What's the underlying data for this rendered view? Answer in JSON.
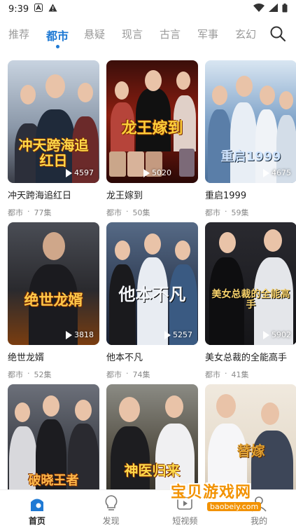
{
  "status_bar": {
    "time": "9:39"
  },
  "tabs": [
    {
      "label": "推荐",
      "active": false
    },
    {
      "label": "都市",
      "active": true
    },
    {
      "label": "悬疑",
      "active": false
    },
    {
      "label": "现言",
      "active": false
    },
    {
      "label": "古言",
      "active": false
    },
    {
      "label": "军事",
      "active": false
    },
    {
      "label": "玄幻",
      "active": false
    }
  ],
  "dramas": [
    {
      "title": "冲天跨海追红日",
      "genre": "都市",
      "episodes": "77集",
      "plays": "4597",
      "poster_text": "冲天跨海追红日",
      "theme": "#b8c6d8"
    },
    {
      "title": "龙王嫁到",
      "genre": "都市",
      "episodes": "50集",
      "plays": "5020",
      "poster_text": "龙王嫁到",
      "theme": "#6b1a12"
    },
    {
      "title": "重启1999",
      "genre": "都市",
      "episodes": "59集",
      "plays": "4675",
      "poster_text": "重启1999",
      "theme": "#5c86b5"
    },
    {
      "title": "绝世龙婿",
      "genre": "都市",
      "episodes": "52集",
      "plays": "3818",
      "poster_text": "绝世龙婿",
      "theme": "#2b2b2f"
    },
    {
      "title": "他本不凡",
      "genre": "都市",
      "episodes": "74集",
      "plays": "5257",
      "poster_text": "他本不凡",
      "theme": "#33445e"
    },
    {
      "title": "美女总裁的全能高手",
      "genre": "都市",
      "episodes": "41集",
      "plays": "5902",
      "poster_text": "美女总裁的全能高手",
      "theme": "#1e1e22"
    },
    {
      "title": "",
      "genre": "",
      "episodes": "",
      "plays": "",
      "poster_text": "破晓王者",
      "theme": "#4a4d55"
    },
    {
      "title": "",
      "genre": "",
      "episodes": "",
      "plays": "",
      "poster_text": "神医归来",
      "theme": "#4f4a3e"
    },
    {
      "title": "",
      "genre": "",
      "episodes": "",
      "plays": "",
      "poster_text": "替嫁",
      "theme": "#e6dccc"
    }
  ],
  "meta_separator": "·",
  "bottom_nav": [
    {
      "label": "首页",
      "icon": "home-icon",
      "active": true
    },
    {
      "label": "发现",
      "icon": "bulb-icon",
      "active": false
    },
    {
      "label": "短视频",
      "icon": "video-icon",
      "active": false
    },
    {
      "label": "我的",
      "icon": "user-icon",
      "active": false
    }
  ],
  "watermark": {
    "name": "宝贝游戏网",
    "url": "baobeiy.com"
  },
  "colors": {
    "accent": "#1f7ad4",
    "watermark": "#f29200"
  }
}
